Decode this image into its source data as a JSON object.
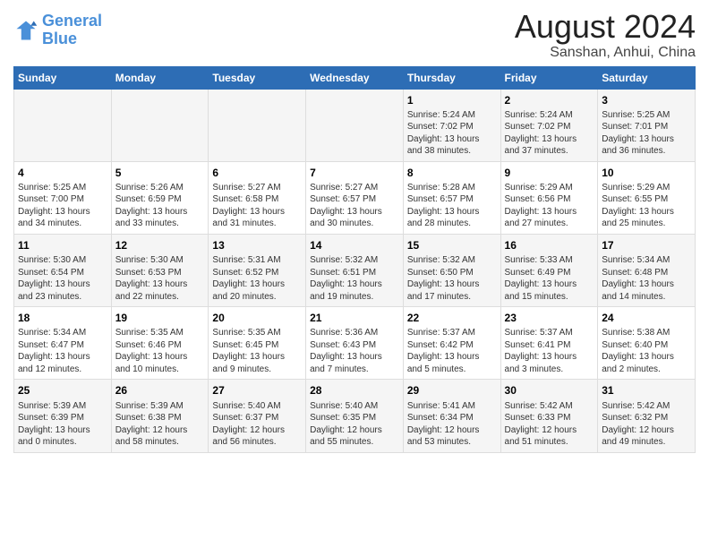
{
  "logo": {
    "line1": "General",
    "line2": "Blue"
  },
  "title": "August 2024",
  "subtitle": "Sanshan, Anhui, China",
  "days_of_week": [
    "Sunday",
    "Monday",
    "Tuesday",
    "Wednesday",
    "Thursday",
    "Friday",
    "Saturday"
  ],
  "weeks": [
    [
      {
        "num": "",
        "text": ""
      },
      {
        "num": "",
        "text": ""
      },
      {
        "num": "",
        "text": ""
      },
      {
        "num": "",
        "text": ""
      },
      {
        "num": "1",
        "text": "Sunrise: 5:24 AM\nSunset: 7:02 PM\nDaylight: 13 hours\nand 38 minutes."
      },
      {
        "num": "2",
        "text": "Sunrise: 5:24 AM\nSunset: 7:02 PM\nDaylight: 13 hours\nand 37 minutes."
      },
      {
        "num": "3",
        "text": "Sunrise: 5:25 AM\nSunset: 7:01 PM\nDaylight: 13 hours\nand 36 minutes."
      }
    ],
    [
      {
        "num": "4",
        "text": "Sunrise: 5:25 AM\nSunset: 7:00 PM\nDaylight: 13 hours\nand 34 minutes."
      },
      {
        "num": "5",
        "text": "Sunrise: 5:26 AM\nSunset: 6:59 PM\nDaylight: 13 hours\nand 33 minutes."
      },
      {
        "num": "6",
        "text": "Sunrise: 5:27 AM\nSunset: 6:58 PM\nDaylight: 13 hours\nand 31 minutes."
      },
      {
        "num": "7",
        "text": "Sunrise: 5:27 AM\nSunset: 6:57 PM\nDaylight: 13 hours\nand 30 minutes."
      },
      {
        "num": "8",
        "text": "Sunrise: 5:28 AM\nSunset: 6:57 PM\nDaylight: 13 hours\nand 28 minutes."
      },
      {
        "num": "9",
        "text": "Sunrise: 5:29 AM\nSunset: 6:56 PM\nDaylight: 13 hours\nand 27 minutes."
      },
      {
        "num": "10",
        "text": "Sunrise: 5:29 AM\nSunset: 6:55 PM\nDaylight: 13 hours\nand 25 minutes."
      }
    ],
    [
      {
        "num": "11",
        "text": "Sunrise: 5:30 AM\nSunset: 6:54 PM\nDaylight: 13 hours\nand 23 minutes."
      },
      {
        "num": "12",
        "text": "Sunrise: 5:30 AM\nSunset: 6:53 PM\nDaylight: 13 hours\nand 22 minutes."
      },
      {
        "num": "13",
        "text": "Sunrise: 5:31 AM\nSunset: 6:52 PM\nDaylight: 13 hours\nand 20 minutes."
      },
      {
        "num": "14",
        "text": "Sunrise: 5:32 AM\nSunset: 6:51 PM\nDaylight: 13 hours\nand 19 minutes."
      },
      {
        "num": "15",
        "text": "Sunrise: 5:32 AM\nSunset: 6:50 PM\nDaylight: 13 hours\nand 17 minutes."
      },
      {
        "num": "16",
        "text": "Sunrise: 5:33 AM\nSunset: 6:49 PM\nDaylight: 13 hours\nand 15 minutes."
      },
      {
        "num": "17",
        "text": "Sunrise: 5:34 AM\nSunset: 6:48 PM\nDaylight: 13 hours\nand 14 minutes."
      }
    ],
    [
      {
        "num": "18",
        "text": "Sunrise: 5:34 AM\nSunset: 6:47 PM\nDaylight: 13 hours\nand 12 minutes."
      },
      {
        "num": "19",
        "text": "Sunrise: 5:35 AM\nSunset: 6:46 PM\nDaylight: 13 hours\nand 10 minutes."
      },
      {
        "num": "20",
        "text": "Sunrise: 5:35 AM\nSunset: 6:45 PM\nDaylight: 13 hours\nand 9 minutes."
      },
      {
        "num": "21",
        "text": "Sunrise: 5:36 AM\nSunset: 6:43 PM\nDaylight: 13 hours\nand 7 minutes."
      },
      {
        "num": "22",
        "text": "Sunrise: 5:37 AM\nSunset: 6:42 PM\nDaylight: 13 hours\nand 5 minutes."
      },
      {
        "num": "23",
        "text": "Sunrise: 5:37 AM\nSunset: 6:41 PM\nDaylight: 13 hours\nand 3 minutes."
      },
      {
        "num": "24",
        "text": "Sunrise: 5:38 AM\nSunset: 6:40 PM\nDaylight: 13 hours\nand 2 minutes."
      }
    ],
    [
      {
        "num": "25",
        "text": "Sunrise: 5:39 AM\nSunset: 6:39 PM\nDaylight: 13 hours\nand 0 minutes."
      },
      {
        "num": "26",
        "text": "Sunrise: 5:39 AM\nSunset: 6:38 PM\nDaylight: 12 hours\nand 58 minutes."
      },
      {
        "num": "27",
        "text": "Sunrise: 5:40 AM\nSunset: 6:37 PM\nDaylight: 12 hours\nand 56 minutes."
      },
      {
        "num": "28",
        "text": "Sunrise: 5:40 AM\nSunset: 6:35 PM\nDaylight: 12 hours\nand 55 minutes."
      },
      {
        "num": "29",
        "text": "Sunrise: 5:41 AM\nSunset: 6:34 PM\nDaylight: 12 hours\nand 53 minutes."
      },
      {
        "num": "30",
        "text": "Sunrise: 5:42 AM\nSunset: 6:33 PM\nDaylight: 12 hours\nand 51 minutes."
      },
      {
        "num": "31",
        "text": "Sunrise: 5:42 AM\nSunset: 6:32 PM\nDaylight: 12 hours\nand 49 minutes."
      }
    ]
  ]
}
